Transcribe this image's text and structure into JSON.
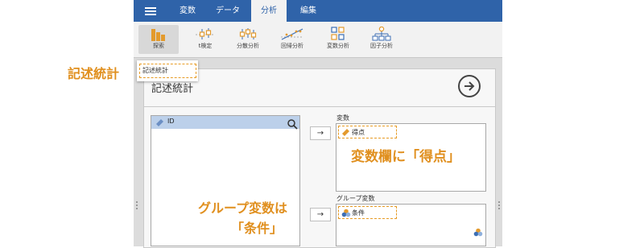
{
  "menu": {
    "tabs": [
      {
        "label": "変数"
      },
      {
        "label": "データ"
      },
      {
        "label": "分析"
      },
      {
        "label": "編集"
      }
    ]
  },
  "ribbon": {
    "buttons": [
      {
        "label": "探索",
        "icon": "bar-chart-icon"
      },
      {
        "label": "t検定",
        "icon": "t-test-icon"
      },
      {
        "label": "分散分析",
        "icon": "anova-icon"
      },
      {
        "label": "回帰分析",
        "icon": "regression-icon"
      },
      {
        "label": "変数分析",
        "icon": "grid-icon"
      },
      {
        "label": "因子分析",
        "icon": "factor-tree-icon"
      }
    ]
  },
  "dropdown": {
    "item": "記述統計"
  },
  "panel": {
    "title": "記述統計"
  },
  "source_list": {
    "items": [
      {
        "label": "ID"
      }
    ]
  },
  "variables": {
    "label": "変数",
    "items": [
      {
        "label": "得点"
      }
    ]
  },
  "group_variables": {
    "label": "グループ変数",
    "items": [
      {
        "label": "条件"
      }
    ]
  },
  "arrow_symbol": "→",
  "callouts": {
    "left": "記述統計",
    "variables": "変数欄に「得点」",
    "group_line1": "グループ変数は",
    "group_line2": "「条件」"
  },
  "colors": {
    "topbar": "#2f63a9",
    "accent": "#e79c26",
    "selection": "#bcd0ea",
    "icon_orange": "#e39a2d",
    "icon_blue": "#3d6fb4"
  }
}
